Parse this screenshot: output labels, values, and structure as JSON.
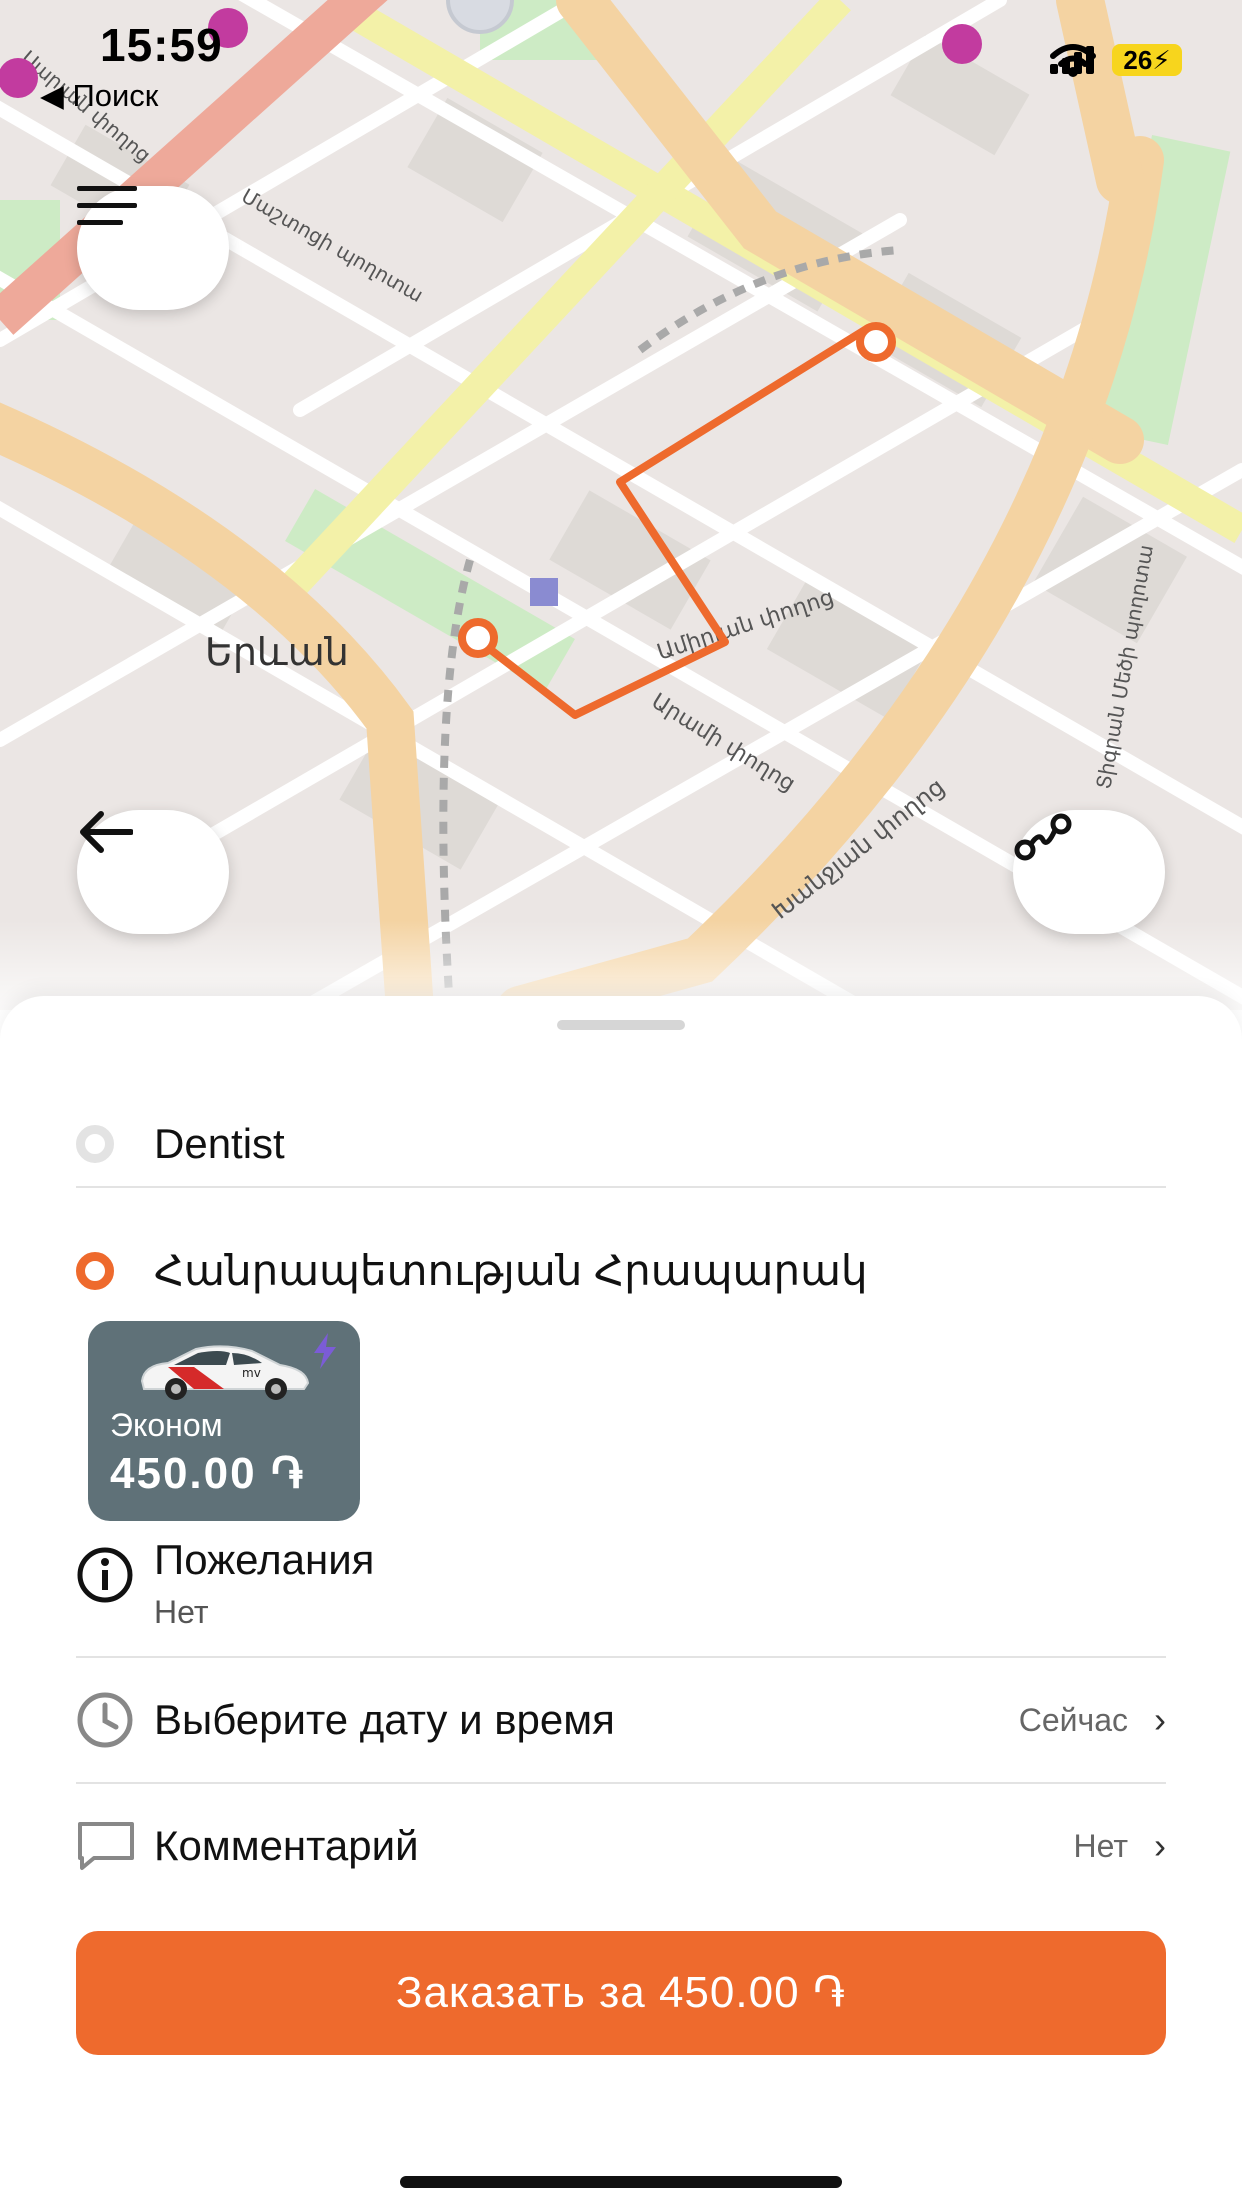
{
  "status_bar": {
    "time": "15:59",
    "back_label": "◀ Поиск",
    "battery": "26⚡"
  },
  "map": {
    "city_label": "Երևան",
    "street_labels": [
      "Մաշտոցի պողոտա",
      "Ամիրյան փողոց",
      "Արամի փողոց",
      "Խանջյան փողոց",
      "Տիգրան Մեծի պողոտա",
      "Սարյան փողոց"
    ],
    "route_color": "#ee6a2d"
  },
  "buttons": {
    "menu_icon": "hamburger-icon",
    "back_icon": "arrow-left-icon",
    "route_icon": "route-icon"
  },
  "route": {
    "from": "Dentist",
    "to": "Հանրապետության Հրապարակ"
  },
  "tariff": {
    "name": "Эконом",
    "price": "450.00 ֏"
  },
  "wishes": {
    "title": "Пожелания",
    "value": "Нет"
  },
  "options": {
    "datetime_label": "Выберите дату и время",
    "datetime_value": "Сейчас",
    "comment_label": "Комментарий",
    "comment_value": "Нет",
    "chevron": "›"
  },
  "order_button": "Заказать за 450.00 ֏",
  "colors": {
    "accent": "#ee6a2d",
    "tariff_card": "#5f7178"
  }
}
